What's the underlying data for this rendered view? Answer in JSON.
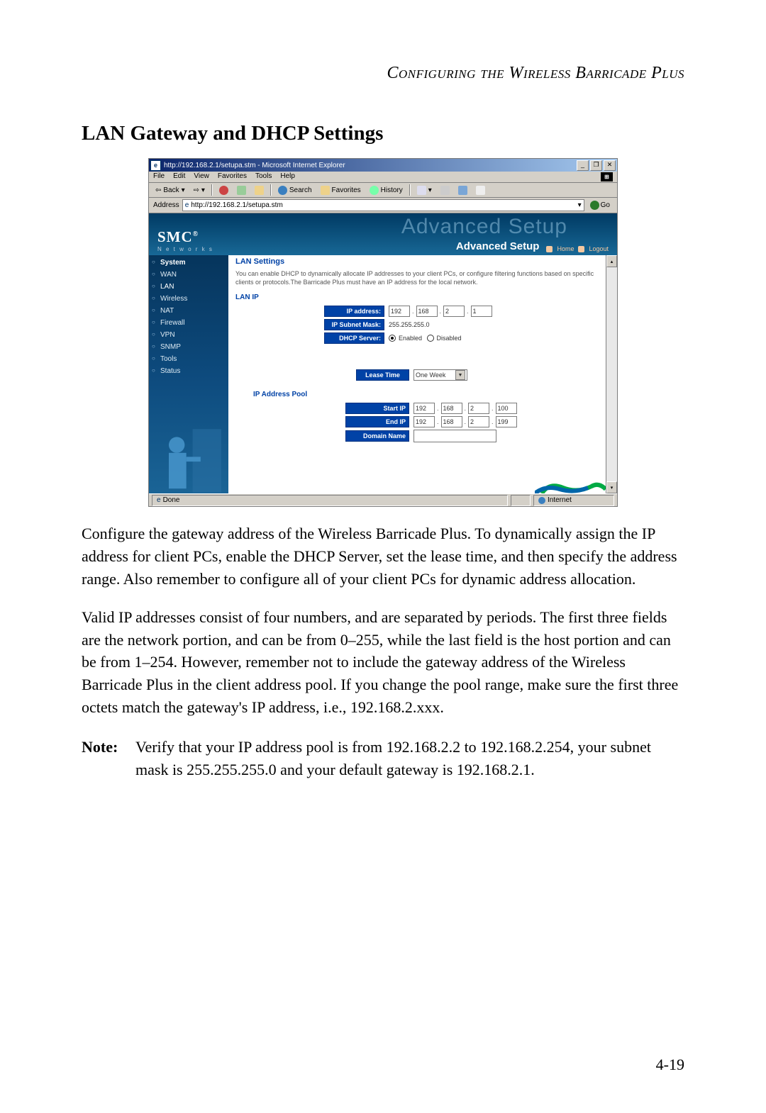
{
  "doc": {
    "running_head": "Configuring the Wireless Barricade Plus",
    "section_title": "LAN Gateway and DHCP Settings",
    "para1": "Configure the gateway address of the Wireless Barricade Plus. To dynamically assign the IP address for client PCs, enable the DHCP Server, set the lease time, and then specify the address range. Also remember to configure all of your client PCs for dynamic address allocation.",
    "para2": "Valid IP addresses consist of four numbers, and are separated by periods. The first three fields are the network portion, and can be from 0–255, while the last field is the host portion and can be from 1–254. However, remember not to include the gateway address of the Wireless Barricade Plus in the client address pool. If you change the pool range, make sure the first three octets match the gateway's IP address, i.e., 192.168.2.xxx.",
    "note_label": "Note:",
    "note_text": "Verify that your IP address pool is from 192.168.2.2 to 192.168.2.254, your subnet mask is 255.255.255.0 and your default gateway is 192.168.2.1.",
    "page_number": "4-19"
  },
  "browser": {
    "title": "http://192.168.2.1/setupa.stm - Microsoft Internet Explorer",
    "menus": [
      "File",
      "Edit",
      "View",
      "Favorites",
      "Tools",
      "Help"
    ],
    "toolbar": {
      "back": "Back",
      "search": "Search",
      "favorites": "Favorites",
      "history": "History"
    },
    "address_label": "Address",
    "address_value": "http://192.168.2.1/setupa.stm",
    "go": "Go",
    "status_done": "Done",
    "status_zone": "Internet"
  },
  "router": {
    "brand": "SMC",
    "brand_sub": "N e t w o r k s",
    "banner_watermark": "Advanced Setup",
    "banner_label": "Advanced Setup",
    "links": {
      "home": "Home",
      "logout": "Logout"
    },
    "sidebar": [
      "System",
      "WAN",
      "LAN",
      "Wireless",
      "NAT",
      "Firewall",
      "VPN",
      "SNMP",
      "Tools",
      "Status"
    ],
    "main": {
      "heading": "LAN Settings",
      "description": "You can enable DHCP to dynamically allocate IP addresses to your client PCs, or configure filtering functions based on specific clients or protocols.The Barricade Plus must have an IP address for the local network.",
      "lan_ip_section": "LAN IP",
      "ip_address_label": "IP address:",
      "ip_address": [
        "192",
        "168",
        "2",
        "1"
      ],
      "subnet_label": "IP Subnet Mask:",
      "subnet_value": "255.255.255.0",
      "dhcp_label": "DHCP Server:",
      "dhcp_enabled": "Enabled",
      "dhcp_disabled": "Disabled",
      "lease_label": "Lease Time",
      "lease_value": "One Week",
      "pool_section": "IP Address Pool",
      "start_label": "Start IP",
      "start_ip": [
        "192",
        "168",
        "2",
        "100"
      ],
      "end_label": "End IP",
      "end_ip": [
        "192",
        "168",
        "2",
        "199"
      ],
      "domain_label": "Domain Name",
      "domain_value": ""
    }
  }
}
